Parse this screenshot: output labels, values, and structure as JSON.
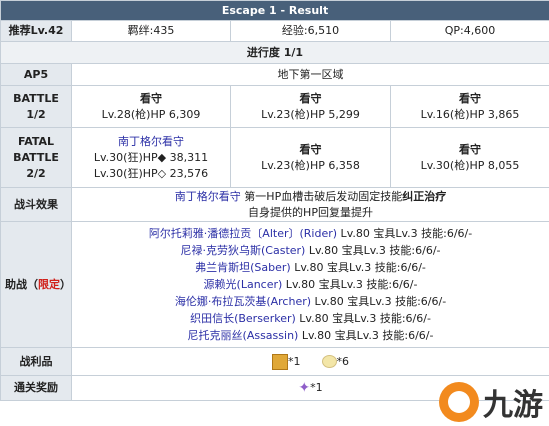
{
  "title": "Escape 1 - Result",
  "info": {
    "label": "推荐Lv.42",
    "bond": "羁绊:435",
    "exp": "经验:6,510",
    "qp": "QP:4,600"
  },
  "progress": "进行度 1/1",
  "ap": {
    "label": "AP5",
    "value": "地下第一区域"
  },
  "battle1": {
    "label_line1": "BATTLE",
    "label_line2": "1/2",
    "enemies": [
      {
        "name": "看守",
        "stat": "Lv.28(枪)HP 6,309"
      },
      {
        "name": "看守",
        "stat": "Lv.23(枪)HP 5,299"
      },
      {
        "name": "看守",
        "stat": "Lv.16(枪)HP 3,865"
      }
    ]
  },
  "battle2": {
    "label_line1": "FATAL",
    "label_line2": "BATTLE",
    "label_line3": "2/2",
    "boss": {
      "name": "南丁格尔看守",
      "stat1": "Lv.30(狂)HP◆ 38,311",
      "stat2": "Lv.30(狂)HP◇ 23,576"
    },
    "enemies": [
      {
        "name": "看守",
        "stat": "Lv.23(枪)HP 6,358"
      },
      {
        "name": "看守",
        "stat": "Lv.30(枪)HP 8,055"
      }
    ]
  },
  "effect": {
    "label": "战斗效果",
    "line1_name": "南丁格尔看守",
    "line1_text": " 第一HP血槽击破后发动固定技能",
    "line1_bold": "纠正治疗",
    "line2": "自身提供的HP回复量提升"
  },
  "support": {
    "label_a": "助战（",
    "label_b": "限定",
    "label_c": "）",
    "items": [
      {
        "name": "阿尔托莉雅·潘德拉贡〔Alter〕(Rider)",
        "rest": " Lv.80 宝具Lv.3 技能:6/6/-"
      },
      {
        "name": "尼禄·克劳狄乌斯(Caster)",
        "rest": " Lv.80 宝具Lv.3 技能:6/6/-"
      },
      {
        "name": "弗兰肯斯坦(Saber)",
        "rest": " Lv.80 宝具Lv.3 技能:6/6/-"
      },
      {
        "name": "源赖光(Lancer)",
        "rest": " Lv.80 宝具Lv.3 技能:6/6/-"
      },
      {
        "name": "海伦娜·布拉瓦茨基(Archer)",
        "rest": " Lv.80 宝具Lv.3 技能:6/6/-"
      },
      {
        "name": "织田信长(Berserker)",
        "rest": " Lv.80 宝具Lv.3 技能:6/6/-"
      },
      {
        "name": "尼托克丽丝(Assassin)",
        "rest": " Lv.80 宝具Lv.3 技能:6/6/-"
      }
    ]
  },
  "loot": {
    "label": "战利品",
    "item1_count": "*1",
    "item2_count": "*6"
  },
  "reward": {
    "label": "通关奖励",
    "count": "*1"
  },
  "watermark": "九游"
}
